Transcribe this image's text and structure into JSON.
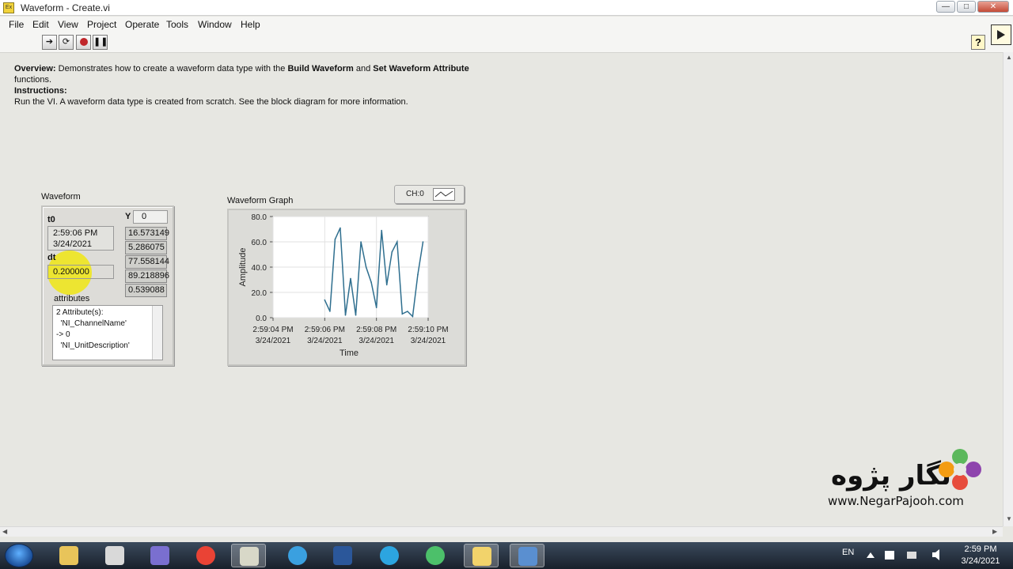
{
  "window": {
    "title": "Waveform - Create.vi",
    "app_icon_text": "Ex"
  },
  "menu": [
    "File",
    "Edit",
    "View",
    "Project",
    "Operate",
    "Tools",
    "Window",
    "Help"
  ],
  "toolbar": {
    "help_label": "?"
  },
  "description": {
    "overview_label": "Overview:",
    "overview_text_1": " Demonstrates how to create a waveform data type with the ",
    "build_waveform": "Build Waveform",
    "and": " and ",
    "set_attr": "Set Waveform Attribute",
    "overview_text_2": "functions.",
    "instructions_label": "Instructions:",
    "instructions_text": "Run the VI. A waveform data type is created from scratch. See the block diagram for more information."
  },
  "waveform_control": {
    "label": "Waveform",
    "t0_label": "t0",
    "t0_time": "2:59:06 PM",
    "t0_date": "3/24/2021",
    "dt_label": "dt",
    "dt_value": "0.200000",
    "y_label": "Y",
    "y_index": "0",
    "y_values": [
      "16.573149",
      "5.286075",
      "77.558144",
      "89.218896",
      "0.539088"
    ],
    "attributes_label": "attributes",
    "attributes_lines": [
      "2 Attribute(s):",
      "  'NI_ChannelName'",
      "-> 0",
      "  'NI_UnitDescription'"
    ]
  },
  "graph": {
    "label": "Waveform Graph",
    "legend_label": "CH:0",
    "line_color": "#2f6f8f"
  },
  "chart_data": {
    "type": "line",
    "title": "",
    "xlabel": "Time",
    "ylabel": "Amplitude",
    "ylim": [
      0,
      80
    ],
    "yticks": [
      "0.0",
      "20.0",
      "40.0",
      "60.0",
      "80.0"
    ],
    "xticks": [
      {
        "time": "2:59:04 PM",
        "date": "3/24/2021"
      },
      {
        "time": "2:59:06 PM",
        "date": "3/24/2021"
      },
      {
        "time": "2:59:08 PM",
        "date": "3/24/2021"
      },
      {
        "time": "2:59:10 PM",
        "date": "3/24/2021"
      }
    ],
    "xlim_seconds": [
      0,
      6
    ],
    "grid": true,
    "series": [
      {
        "x": [
          2.0,
          2.2,
          2.4,
          2.6,
          2.8,
          3.0,
          3.2,
          3.4,
          3.6,
          3.8,
          4.0,
          4.2,
          4.4,
          4.6,
          4.8,
          5.0,
          5.2,
          5.4,
          5.6,
          5.8
        ],
        "values": [
          14,
          5,
          62,
          71,
          2,
          31,
          2,
          60,
          40,
          28,
          8,
          69,
          26,
          52,
          60,
          3,
          5,
          1,
          34,
          60
        ]
      }
    ]
  },
  "watermark": {
    "fa": "نگار پژوه",
    "url": "www.NegarPajooh.com"
  },
  "taskbar": {
    "items": [
      "explorer-icon",
      "calendar-icon",
      "media-icon",
      "chrome-icon",
      "labview-icon",
      "globe-icon",
      "word-icon",
      "telegram-icon",
      "telegram-alt-icon",
      "folder-icon",
      "search-app-icon"
    ],
    "lang": "EN",
    "time": "2:59 PM",
    "date": "3/24/2021"
  }
}
